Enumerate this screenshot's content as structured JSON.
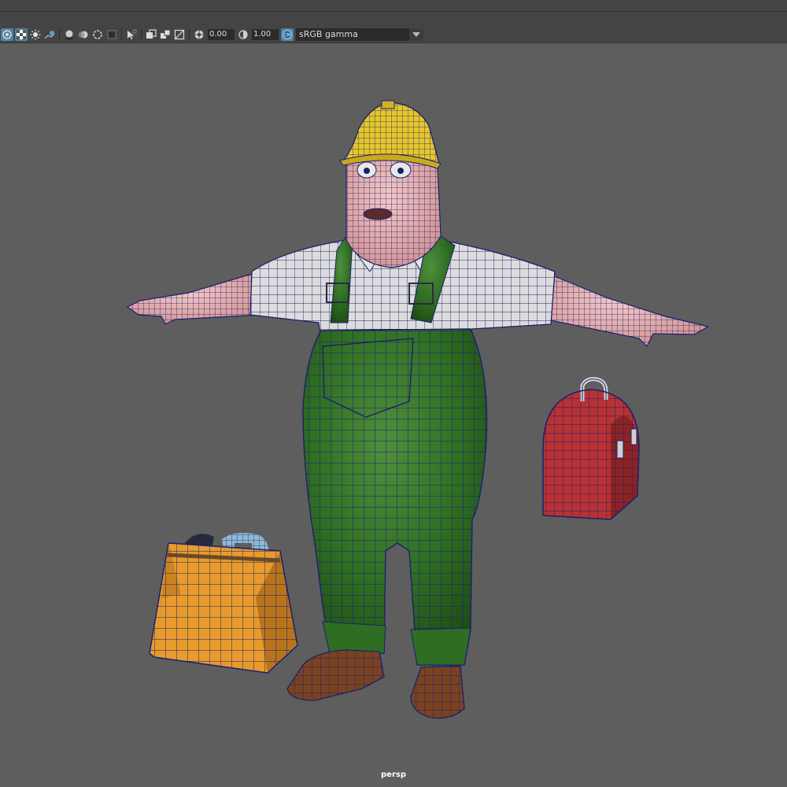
{
  "viewport": {
    "camera_label": "persp"
  },
  "toolbar": {
    "exposure_value": "0.00",
    "gamma_value": "1.00",
    "color_space": "sRGB gamma",
    "icons": [
      "grid-icon",
      "checker-icon",
      "light-icon",
      "shadow-icon",
      "ambient-occlusion-icon",
      "motion-blur-icon",
      "antialias-icon",
      "dof-icon",
      "isolate-icon",
      "xray-icon",
      "xray-joints-icon",
      "xray-active-icon",
      "backface-icon",
      "exposure-icon",
      "gamma-icon",
      "color-management-icon",
      "dropdown-arrow-icon"
    ]
  },
  "colors": {
    "wireframe": "#1c1f6e",
    "helmet": "#e5c62b",
    "skin": "#e8b3b3",
    "shirt": "#dcdcdc",
    "overalls": "#2e6d22",
    "boots": "#7a4320",
    "toolbox": "#e89b2c",
    "lunchbox": "#b73232",
    "background": "#5e5e5e",
    "ui_dark": "#444444",
    "ui_accent": "#5285a6"
  }
}
